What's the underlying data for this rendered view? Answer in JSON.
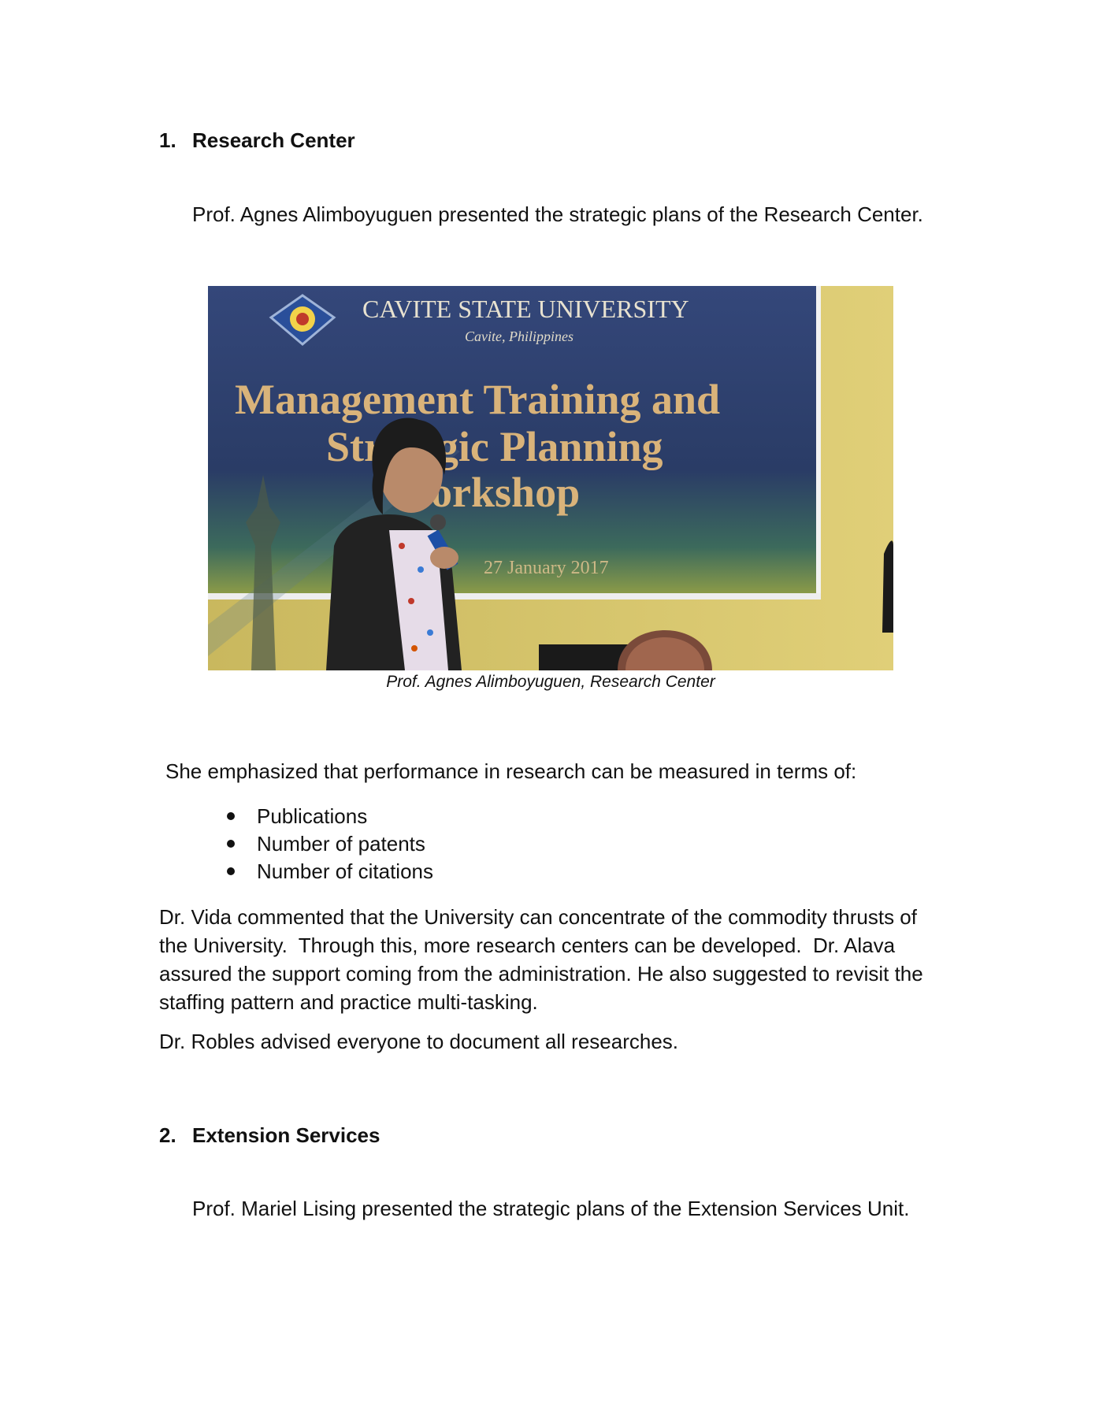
{
  "section1": {
    "number": "1.",
    "title": "Research Center",
    "intro": "Prof. Agnes Alimboyuguen presented the strategic plans of the Research Center."
  },
  "photo": {
    "banner_university": "CAVITE STATE UNIVERSITY",
    "banner_location": "Cavite, Philippines",
    "banner_title_line1": "Management Training and",
    "banner_title_line2": "Strategic Planning",
    "banner_title_line3": "Workshop",
    "banner_date": "27 January 2017",
    "caption": "Prof. Agnes Alimboyuguen, Research Center"
  },
  "performance": {
    "lead": "She emphasized that performance in research can be measured in terms of:",
    "items": [
      "Publications",
      "Number of patents",
      "Number of citations"
    ]
  },
  "comments": {
    "line1": "Dr. Vida commented that the University can concentrate of the commodity thrusts of",
    "line2": "the University.  Through this, more research centers can be developed.  Dr. Alava",
    "line3": "assured the support coming from the administration. He also suggested to revisit the",
    "line4": "staffing pattern and practice multi-tasking."
  },
  "robles": "Dr. Robles advised everyone to document all researches.",
  "section2": {
    "number": "2.",
    "title": "Extension Services",
    "intro": "Prof. Mariel Lising presented the strategic plans of the Extension Services Unit."
  },
  "colors": {
    "banner_blue": "#2c3e6e",
    "banner_gold": "#d8b878",
    "wall_yellow": "#d6c56a"
  }
}
